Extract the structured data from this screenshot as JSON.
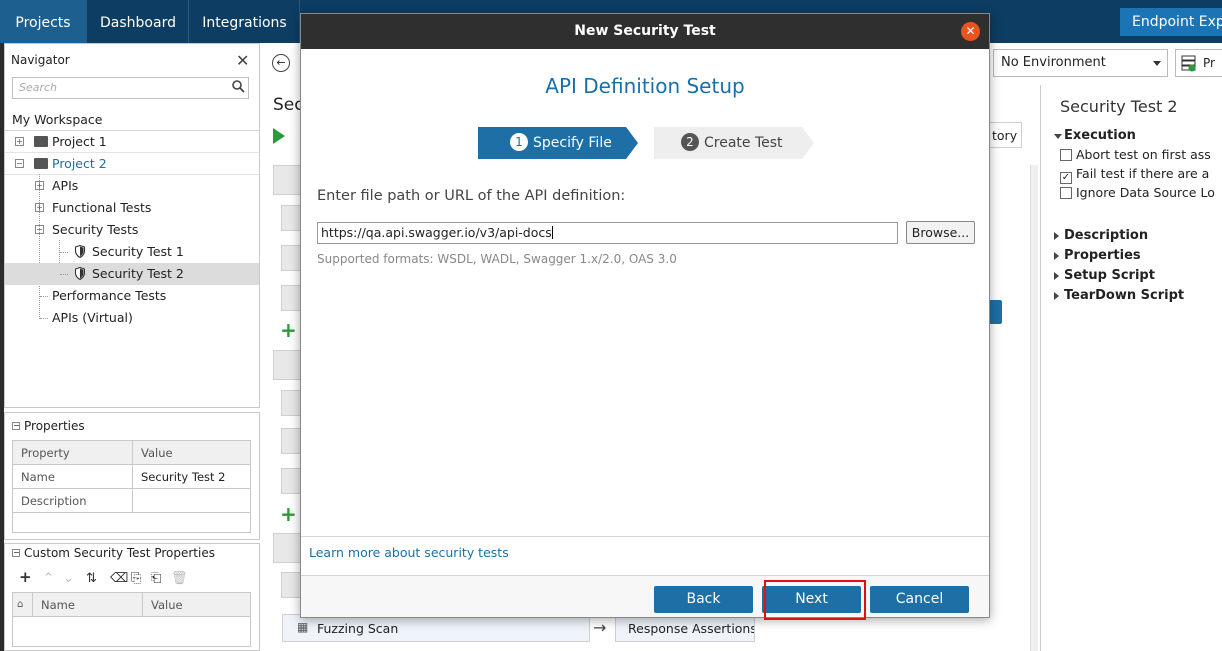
{
  "topbar": {
    "tabs": [
      "Projects",
      "Dashboard",
      "Integrations"
    ],
    "endpoint_button": "Endpoint Exp"
  },
  "navigator": {
    "title": "Navigator",
    "search_placeholder": "Search",
    "workspace": "My Workspace",
    "items": {
      "project1": "Project 1",
      "project2": "Project 2",
      "apis": "APIs",
      "functional_tests": "Functional Tests",
      "security_tests": "Security Tests",
      "security_test1": "Security Test 1",
      "security_test2": "Security Test 2",
      "performance_tests": "Performance Tests",
      "apis_virtual": "APIs (Virtual)"
    }
  },
  "properties": {
    "title": "Properties",
    "columns": [
      "Property",
      "Value"
    ],
    "rows": [
      {
        "property": "Name",
        "value": "Security Test 2"
      },
      {
        "property": "Description",
        "value": ""
      }
    ]
  },
  "custom_props": {
    "title": "Custom Security Test Properties",
    "columns": [
      "Name",
      "Value"
    ]
  },
  "background": {
    "title_fragment": "Sec",
    "history_fragment": "tory",
    "fuzzing_scan": "Fuzzing Scan",
    "response_assertions": "Response Assertions"
  },
  "environment": {
    "selected": "No Environment",
    "extra_fragment": "Pr"
  },
  "right_panel": {
    "title": "Security Test 2",
    "execution": "Execution",
    "options": [
      {
        "label": "Abort test on first ass",
        "checked": false
      },
      {
        "label": "Fail test if there are a",
        "checked": true
      },
      {
        "label": "Ignore Data Source Lo",
        "checked": false
      }
    ],
    "sections": [
      "Description",
      "Properties",
      "Setup Script",
      "TearDown Script"
    ]
  },
  "dialog": {
    "title": "New Security Test",
    "heading": "API Definition Setup",
    "steps": [
      {
        "num": "1",
        "label": "Specify File"
      },
      {
        "num": "2",
        "label": "Create Test"
      }
    ],
    "prompt": "Enter file path or URL of the API definition:",
    "url_value": "https://qa.api.swagger.io/v3/api-docs",
    "browse": "Browse...",
    "formats": "Supported formats: WSDL, WADL, Swagger 1.x/2.0, OAS 3.0",
    "learn_more": "Learn more about security tests",
    "buttons": {
      "back": "Back",
      "next": "Next",
      "cancel": "Cancel"
    }
  },
  "colors": {
    "accent": "#1d6fa5",
    "topbar": "#0d3d63",
    "highlight": "#e01010"
  }
}
